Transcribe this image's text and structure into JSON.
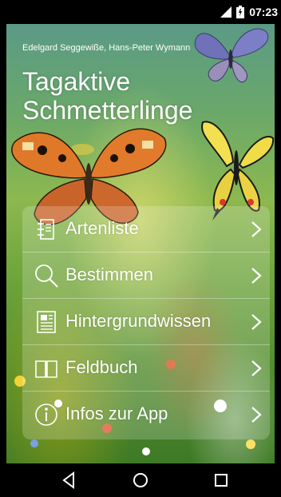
{
  "status_bar": {
    "time": "07:23"
  },
  "header": {
    "authors": "Edelgard Seggewiße, Hans-Peter Wymann",
    "title_line1": "Tagaktive",
    "title_line2": "Schmetterlinge"
  },
  "menu": {
    "items": [
      {
        "label": "Artenliste",
        "icon": "species-list-icon"
      },
      {
        "label": "Bestimmen",
        "icon": "search-icon"
      },
      {
        "label": "Hintergrundwissen",
        "icon": "document-icon"
      },
      {
        "label": "Feldbuch",
        "icon": "book-icon"
      },
      {
        "label": "Infos zur App",
        "icon": "info-icon"
      }
    ]
  },
  "navbar": {
    "back": "back-icon",
    "home": "home-icon",
    "recents": "recents-icon"
  },
  "colors": {
    "menu_overlay": "rgba(255,255,255,0.20)",
    "text": "#ffffff",
    "bar": "#000000"
  }
}
